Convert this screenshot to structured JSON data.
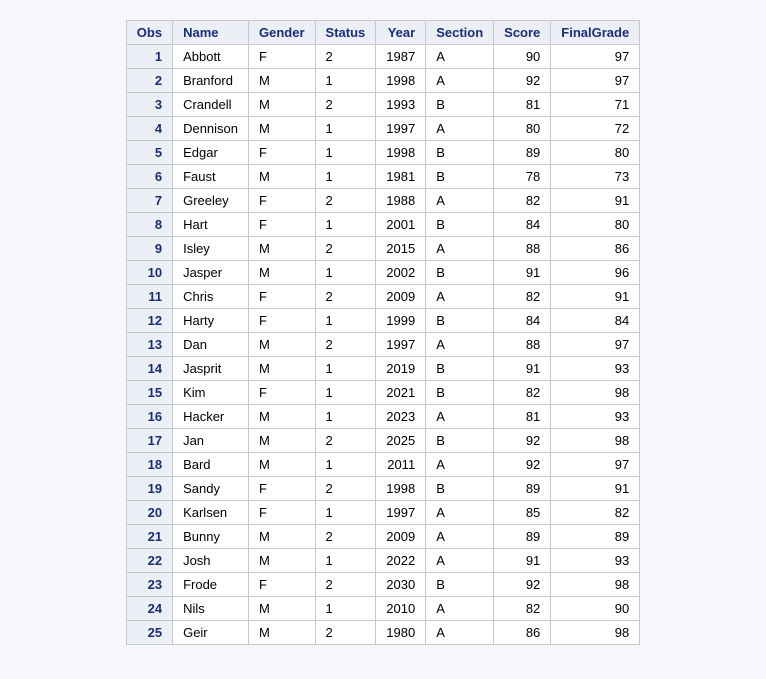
{
  "headers": [
    "Obs",
    "Name",
    "Gender",
    "Status",
    "Year",
    "Section",
    "Score",
    "FinalGrade"
  ],
  "rows": [
    {
      "obs": 1,
      "name": "Abbott",
      "gender": "F",
      "status": "2",
      "year": 1987,
      "section": "A",
      "score": 90,
      "final": 97
    },
    {
      "obs": 2,
      "name": "Branford",
      "gender": "M",
      "status": "1",
      "year": 1998,
      "section": "A",
      "score": 92,
      "final": 97
    },
    {
      "obs": 3,
      "name": "Crandell",
      "gender": "M",
      "status": "2",
      "year": 1993,
      "section": "B",
      "score": 81,
      "final": 71
    },
    {
      "obs": 4,
      "name": "Dennison",
      "gender": "M",
      "status": "1",
      "year": 1997,
      "section": "A",
      "score": 80,
      "final": 72
    },
    {
      "obs": 5,
      "name": "Edgar",
      "gender": "F",
      "status": "1",
      "year": 1998,
      "section": "B",
      "score": 89,
      "final": 80
    },
    {
      "obs": 6,
      "name": "Faust",
      "gender": "M",
      "status": "1",
      "year": 1981,
      "section": "B",
      "score": 78,
      "final": 73
    },
    {
      "obs": 7,
      "name": "Greeley",
      "gender": "F",
      "status": "2",
      "year": 1988,
      "section": "A",
      "score": 82,
      "final": 91
    },
    {
      "obs": 8,
      "name": "Hart",
      "gender": "F",
      "status": "1",
      "year": 2001,
      "section": "B",
      "score": 84,
      "final": 80
    },
    {
      "obs": 9,
      "name": "Isley",
      "gender": "M",
      "status": "2",
      "year": 2015,
      "section": "A",
      "score": 88,
      "final": 86
    },
    {
      "obs": 10,
      "name": "Jasper",
      "gender": "M",
      "status": "1",
      "year": 2002,
      "section": "B",
      "score": 91,
      "final": 96
    },
    {
      "obs": 11,
      "name": "Chris",
      "gender": "F",
      "status": "2",
      "year": 2009,
      "section": "A",
      "score": 82,
      "final": 91
    },
    {
      "obs": 12,
      "name": "Harty",
      "gender": "F",
      "status": "1",
      "year": 1999,
      "section": "B",
      "score": 84,
      "final": 84
    },
    {
      "obs": 13,
      "name": "Dan",
      "gender": "M",
      "status": "2",
      "year": 1997,
      "section": "A",
      "score": 88,
      "final": 97
    },
    {
      "obs": 14,
      "name": "Jasprit",
      "gender": "M",
      "status": "1",
      "year": 2019,
      "section": "B",
      "score": 91,
      "final": 93
    },
    {
      "obs": 15,
      "name": "Kim",
      "gender": "F",
      "status": "1",
      "year": 2021,
      "section": "B",
      "score": 82,
      "final": 98
    },
    {
      "obs": 16,
      "name": "Hacker",
      "gender": "M",
      "status": "1",
      "year": 2023,
      "section": "A",
      "score": 81,
      "final": 93
    },
    {
      "obs": 17,
      "name": "Jan",
      "gender": "M",
      "status": "2",
      "year": 2025,
      "section": "B",
      "score": 92,
      "final": 98
    },
    {
      "obs": 18,
      "name": "Bard",
      "gender": "M",
      "status": "1",
      "year": 2011,
      "section": "A",
      "score": 92,
      "final": 97
    },
    {
      "obs": 19,
      "name": "Sandy",
      "gender": "F",
      "status": "2",
      "year": 1998,
      "section": "B",
      "score": 89,
      "final": 91
    },
    {
      "obs": 20,
      "name": "Karlsen",
      "gender": "F",
      "status": "1",
      "year": 1997,
      "section": "A",
      "score": 85,
      "final": 82
    },
    {
      "obs": 21,
      "name": "Bunny",
      "gender": "M",
      "status": "2",
      "year": 2009,
      "section": "A",
      "score": 89,
      "final": 89
    },
    {
      "obs": 22,
      "name": "Josh",
      "gender": "M",
      "status": "1",
      "year": 2022,
      "section": "A",
      "score": 91,
      "final": 93
    },
    {
      "obs": 23,
      "name": "Frode",
      "gender": "F",
      "status": "2",
      "year": 2030,
      "section": "B",
      "score": 92,
      "final": 98
    },
    {
      "obs": 24,
      "name": "Nils",
      "gender": "M",
      "status": "1",
      "year": 2010,
      "section": "A",
      "score": 82,
      "final": 90
    },
    {
      "obs": 25,
      "name": "Geir",
      "gender": "M",
      "status": "2",
      "year": 1980,
      "section": "A",
      "score": 86,
      "final": 98
    }
  ]
}
